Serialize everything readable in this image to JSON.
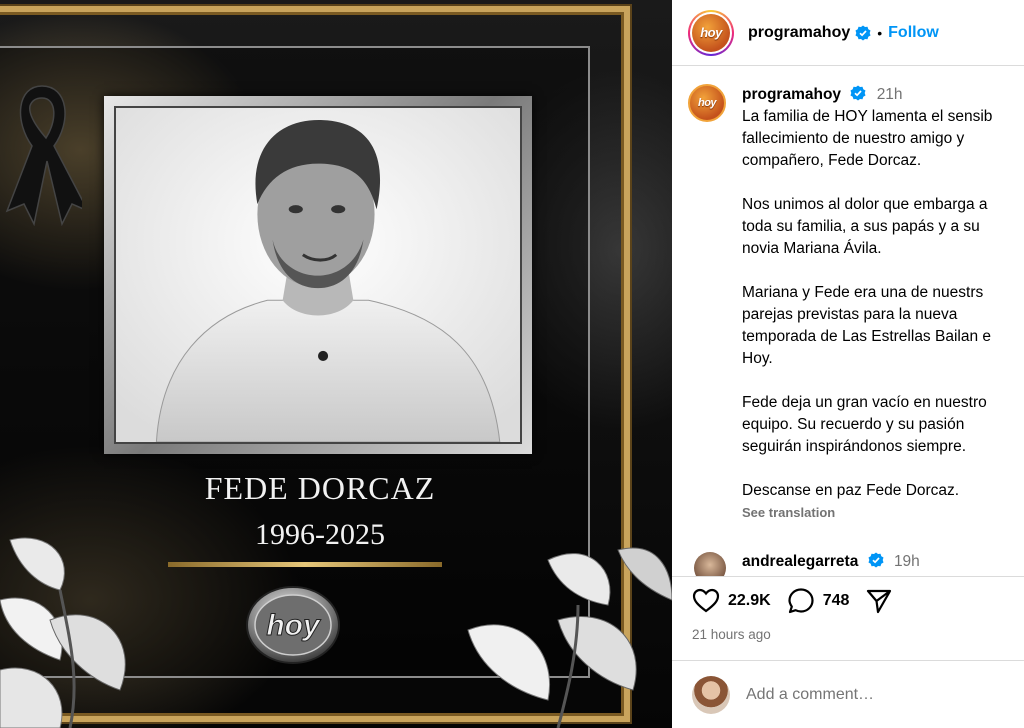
{
  "post": {
    "name": "FEDE DORCAZ",
    "years": "1996-2025",
    "logo_text": "hoy"
  },
  "header": {
    "username": "programahoy",
    "separator": "•",
    "follow_label": "Follow",
    "avatar_text": "hoy"
  },
  "caption": {
    "username": "programahoy",
    "time": "21h",
    "avatar_text": "hoy",
    "paragraphs": [
      "La familia de HOY lamenta el sensib\nfallecimiento de nuestro amigo y\ncompañero, Fede Dorcaz.",
      "Nos unimos al dolor que embarga a\ntoda su familia, a sus papás y a su\nnovia Mariana Ávila.",
      "Mariana y Fede era una de nuestrs\nparejas previstas para la nueva\ntemporada de Las Estrellas Bailan e\nHoy.",
      "Fede deja un gran vacío en nuestro\nequipo. Su recuerdo y su pasión\nseguirán inspirándonos siempre.",
      "Descanse en paz Fede Dorcaz."
    ],
    "see_translation": "See translation"
  },
  "reply": {
    "username": "andrealegarreta",
    "time": "19h"
  },
  "actions": {
    "likes": "22.9K",
    "comments": "748",
    "time_ago": "21 hours ago"
  },
  "comment_box": {
    "placeholder": "Add a comment…"
  },
  "colors": {
    "accent": "#0095f6",
    "gold": "#c9a45c",
    "muted": "#737373"
  }
}
